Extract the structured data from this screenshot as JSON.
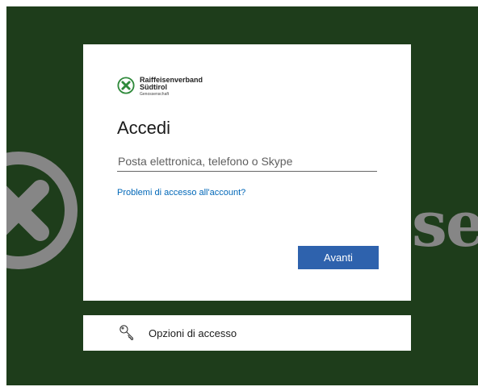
{
  "brand": {
    "name_line1": "Raiffeisenverband",
    "name_line2": "Südtirol",
    "name_line3": "Genossenschaft",
    "background_text": "se",
    "background_color": "#1e3d1b",
    "logo_green": "#2f8a3b"
  },
  "signin": {
    "title": "Accedi",
    "email_placeholder": "Posta elettronica, telefono o Skype",
    "email_value": "",
    "help_link": "Problemi di accesso all'account?",
    "next_label": "Avanti",
    "button_color": "#2e62ad",
    "link_color": "#0067b8"
  },
  "options": {
    "label": "Opzioni di accesso",
    "icon": "key-icon"
  }
}
